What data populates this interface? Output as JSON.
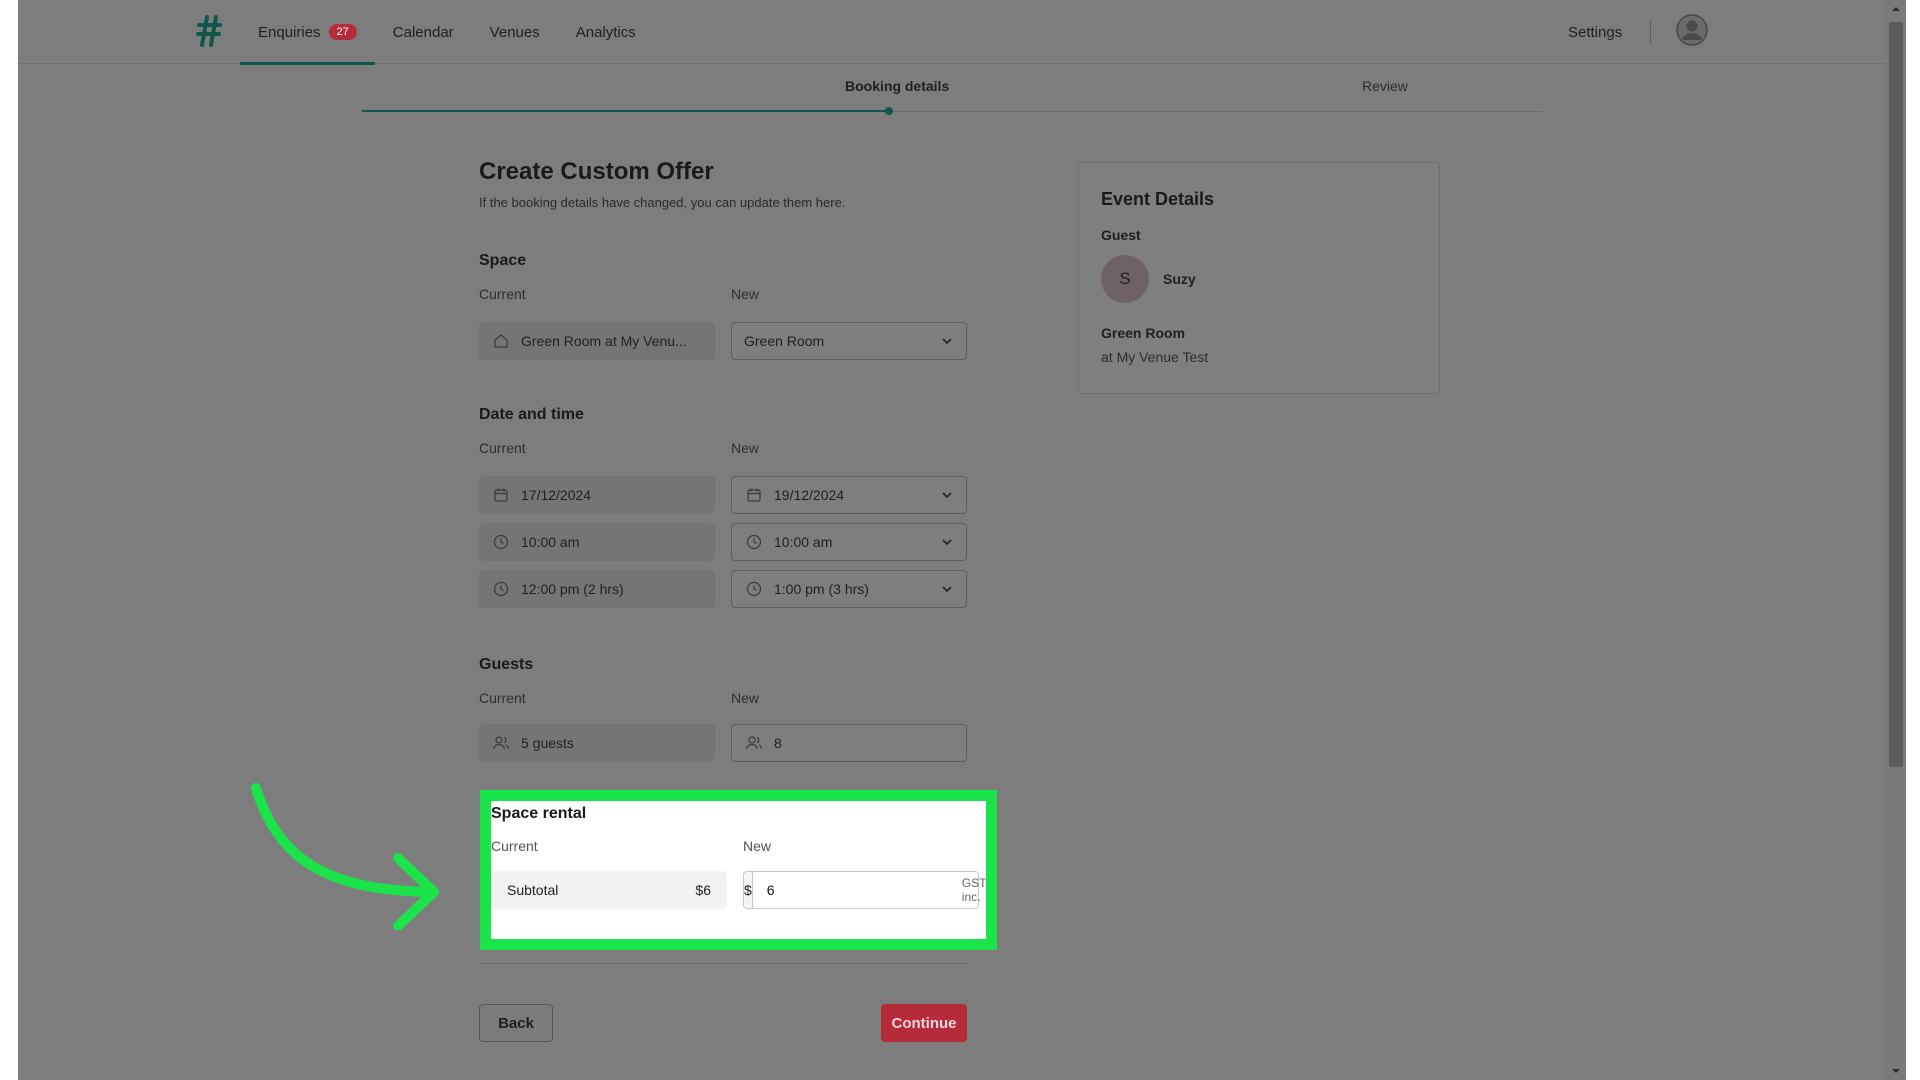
{
  "nav": {
    "items": [
      {
        "label": "Enquiries",
        "badge": "27",
        "active": true
      },
      {
        "label": "Calendar"
      },
      {
        "label": "Venues"
      },
      {
        "label": "Analytics"
      }
    ],
    "settings_label": "Settings"
  },
  "steps": {
    "current": "Booking details",
    "next": "Review"
  },
  "form": {
    "title": "Create Custom Offer",
    "subtitle": "If the booking details have changed, you can update them here.",
    "labels": {
      "current": "Current",
      "new": "New"
    },
    "space": {
      "title": "Space",
      "current": "Green Room at My Venu...",
      "new": "Green Room"
    },
    "datetime": {
      "title": "Date and time",
      "current_date": "17/12/2024",
      "new_date": "19/12/2024",
      "current_start": "10:00 am",
      "new_start": "10:00 am",
      "current_end": "12:00 pm (2 hrs)",
      "new_end": "1:00 pm (3 hrs)"
    },
    "guests": {
      "title": "Guests",
      "current": "5 guests",
      "new": "8"
    },
    "space_rental": {
      "title": "Space rental",
      "subtotal_label": "Subtotal",
      "subtotal_value": "$6",
      "currency": "$",
      "new_value": "6",
      "gst_note": "GST inc."
    },
    "back_label": "Back",
    "continue_label": "Continue"
  },
  "event_details": {
    "title": "Event Details",
    "guest_label": "Guest",
    "guest_initial": "S",
    "guest_name": "Suzy",
    "room": "Green Room",
    "venue": "at My Venue Test"
  },
  "colors": {
    "brand": "#10564b",
    "accent_red": "#b52b3a",
    "highlight": "#1be34a"
  }
}
